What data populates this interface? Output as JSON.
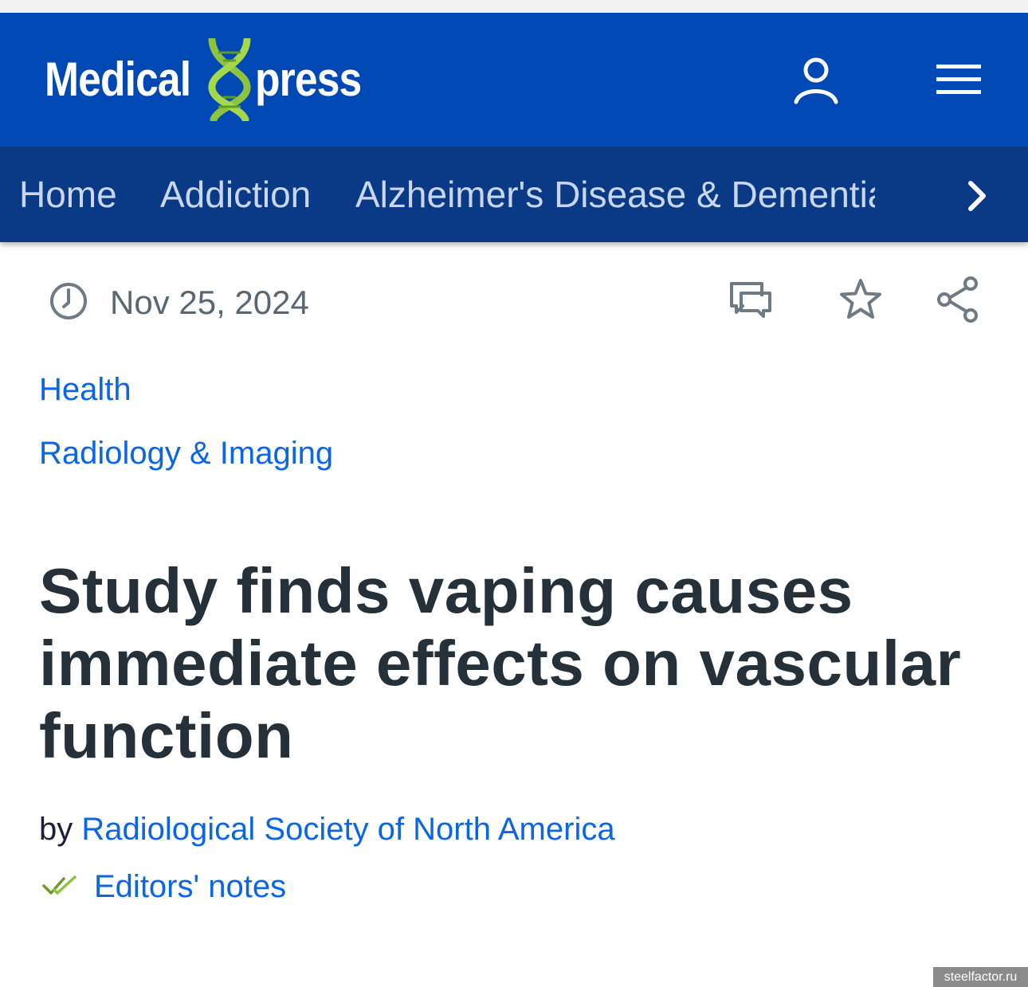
{
  "header": {
    "logo_word_1": "Medical",
    "logo_word_2": "press",
    "brand_color": "#0049b4",
    "accent_color": "#8cc43f",
    "icons": [
      "user-icon",
      "hamburger-menu-icon"
    ]
  },
  "nav": {
    "items": [
      {
        "label": "Home"
      },
      {
        "label": "Addiction"
      },
      {
        "label": "Alzheimer's Disease & Dementia"
      }
    ],
    "background": "#0a3a86",
    "next_icon": "chevron-right-icon"
  },
  "meta": {
    "date": "Nov 25, 2024",
    "icons": [
      "clock-icon",
      "comment-icon",
      "star-icon",
      "share-icon"
    ]
  },
  "categories": [
    {
      "label": "Health"
    },
    {
      "label": "Radiology & Imaging"
    }
  ],
  "article": {
    "title": "Study finds vaping causes immediate effects on vascular function",
    "byline_prefix": "by",
    "author": "Radiological Society of North America",
    "editors_notes": "Editors' notes",
    "editors_icon": "double-check-icon"
  },
  "watermark": "steelfactor.ru"
}
